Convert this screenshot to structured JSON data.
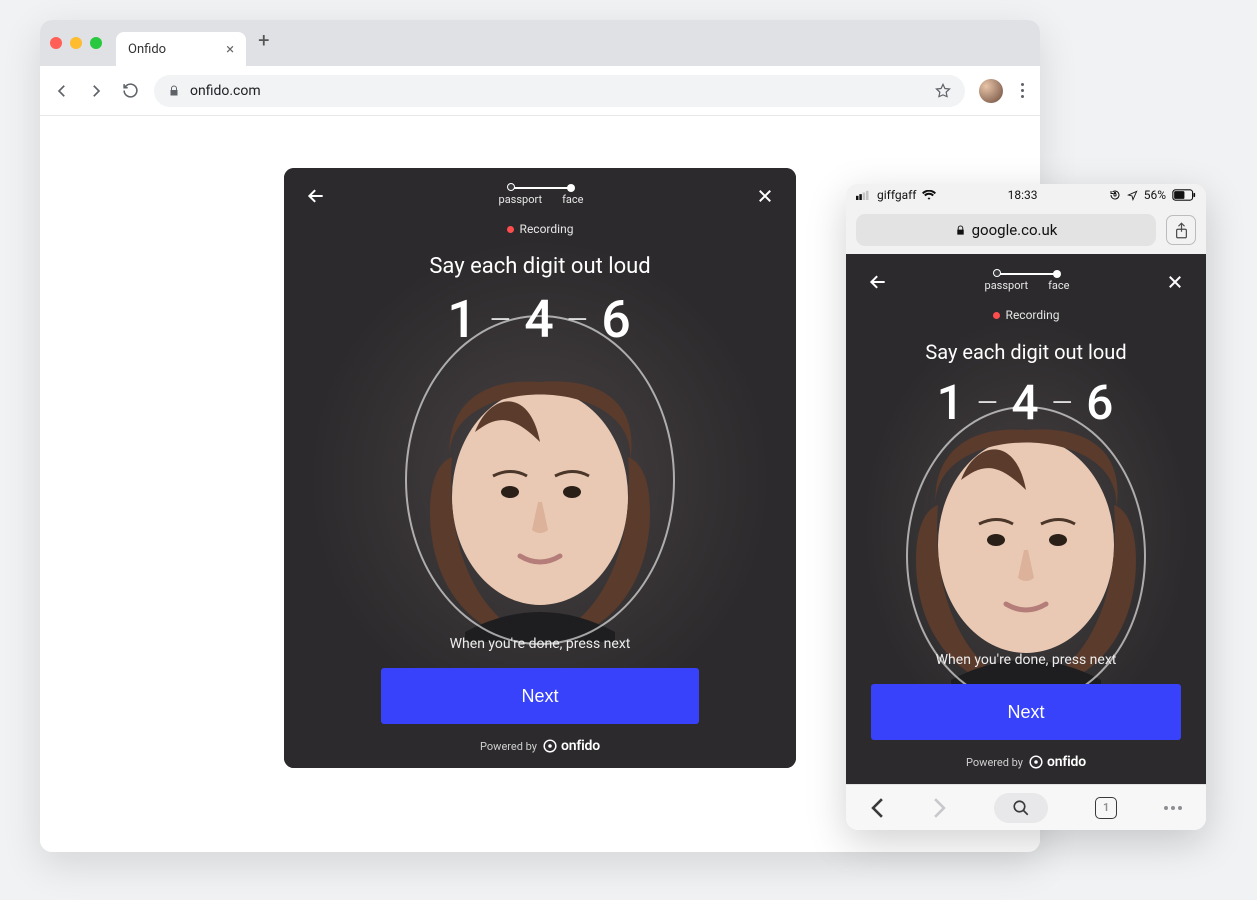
{
  "browser": {
    "tab_title": "Onfido",
    "url": "onfido.com"
  },
  "widget": {
    "stepper": {
      "step1": "passport",
      "step2": "face"
    },
    "recording_label": "Recording",
    "instruction": "Say each digit out loud",
    "digits": {
      "d1": "1",
      "d2": "4",
      "d3": "6"
    },
    "done_hint": "When you're done, press next",
    "next_label": "Next",
    "powered_prefix": "Powered by",
    "brand_name": "onfido"
  },
  "mobile": {
    "carrier": "giffgaff",
    "time": "18:33",
    "battery_pct": "56%",
    "url": "google.co.uk",
    "tab_count": "1"
  }
}
